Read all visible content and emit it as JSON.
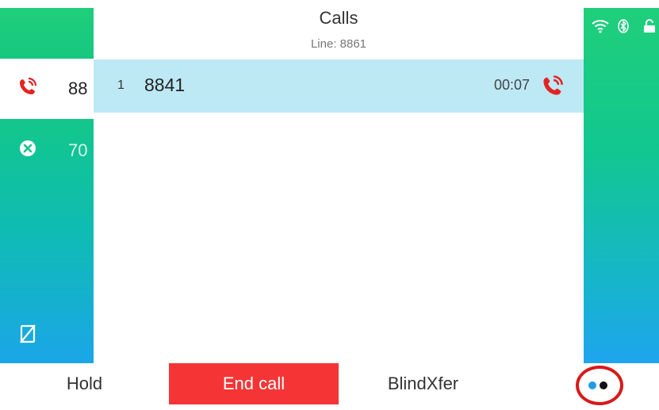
{
  "header": {
    "title": "Calls",
    "subtitle": "Line: 8861"
  },
  "lines": [
    {
      "label": "88",
      "icon": "active-call-icon",
      "color": "#e52222"
    },
    {
      "label": "70",
      "icon": "do-not-disturb-icon",
      "color": "#ffffff"
    }
  ],
  "left_bottom_icon": "no-handset-icon",
  "call": {
    "index": "1",
    "number": "8841",
    "duration": "00:07",
    "icon": "active-call-icon"
  },
  "status_icons": [
    "wifi-icon",
    "bluetooth-icon",
    "unlock-icon"
  ],
  "softkeys": [
    {
      "label": "Hold"
    },
    {
      "label": "End call",
      "color": "#f53535"
    },
    {
      "label": "BlindXfer"
    }
  ],
  "more_button": {
    "icon": "more-dots-icon",
    "highlight_color": "#d81a1a"
  },
  "colors": {
    "call_row": "#bde9f5",
    "accent_green": "#1fcf7a",
    "accent_blue": "#1ea5ee",
    "call_red": "#e52222"
  }
}
